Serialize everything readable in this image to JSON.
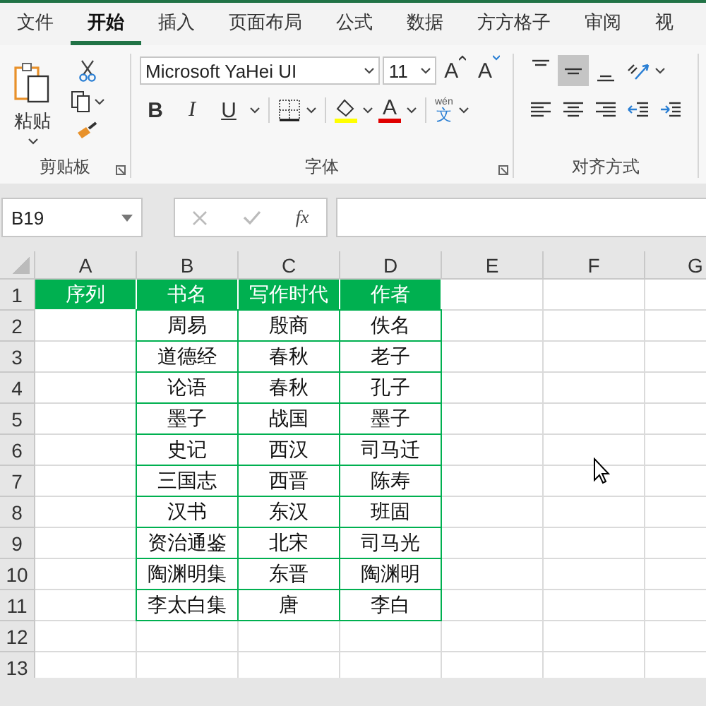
{
  "tabs": [
    {
      "label": "文件",
      "selected": false
    },
    {
      "label": "开始",
      "selected": true
    },
    {
      "label": "插入",
      "selected": false
    },
    {
      "label": "页面布局",
      "selected": false
    },
    {
      "label": "公式",
      "selected": false
    },
    {
      "label": "数据",
      "selected": false
    },
    {
      "label": "方方格子",
      "selected": false
    },
    {
      "label": "审阅",
      "selected": false
    },
    {
      "label": "视",
      "selected": false
    }
  ],
  "ribbon": {
    "clipboard": {
      "paste_label": "粘贴",
      "group_label": "剪贴板"
    },
    "font": {
      "font_name": "Microsoft YaHei UI",
      "font_size": "11",
      "grow_label": "A",
      "shrink_label": "A",
      "bold_label": "B",
      "italic_label": "I",
      "underline_label": "U",
      "font_color_label": "A",
      "phonetic_top": "wén",
      "phonetic_label": "文",
      "group_label": "字体"
    },
    "alignment": {
      "group_label": "对齐方式",
      "buttons": [
        {
          "kind": "top",
          "selected": false
        },
        {
          "kind": "middle",
          "selected": true
        },
        {
          "kind": "bottom",
          "selected": false
        },
        {
          "kind": "orientation",
          "selected": false
        },
        {
          "kind": "left",
          "selected": false
        },
        {
          "kind": "center",
          "selected": false
        },
        {
          "kind": "right",
          "selected": false
        },
        {
          "kind": "outdent",
          "selected": false
        },
        {
          "kind": "indent",
          "selected": false
        }
      ]
    }
  },
  "formula_bar": {
    "name_box": "B19",
    "fx_label": "fx"
  },
  "sheet": {
    "columns": [
      "A",
      "B",
      "C",
      "D",
      "E",
      "F",
      "G"
    ],
    "row_numbers": [
      "1",
      "2",
      "3",
      "4",
      "5",
      "6",
      "7",
      "8",
      "9",
      "10",
      "11",
      "12",
      "13"
    ],
    "table": {
      "headings": [
        "序列",
        "书名",
        "写作时代",
        "作者"
      ],
      "rows": [
        {
          "title": "周易",
          "era": "殷商",
          "author": "佚名"
        },
        {
          "title": "道德经",
          "era": "春秋",
          "author": "老子"
        },
        {
          "title": "论语",
          "era": "春秋",
          "author": "孔子"
        },
        {
          "title": "墨子",
          "era": "战国",
          "author": "墨子"
        },
        {
          "title": "史记",
          "era": "西汉",
          "author": "司马迁"
        },
        {
          "title": "三国志",
          "era": "西晋",
          "author": "陈寿"
        },
        {
          "title": "汉书",
          "era": "东汉",
          "author": "班固"
        },
        {
          "title": "资治通鉴",
          "era": "北宋",
          "author": "司马光"
        },
        {
          "title": "陶渊明集",
          "era": "东晋",
          "author": "陶渊明"
        },
        {
          "title": "李太白集",
          "era": "唐",
          "author": "李白"
        }
      ]
    }
  }
}
